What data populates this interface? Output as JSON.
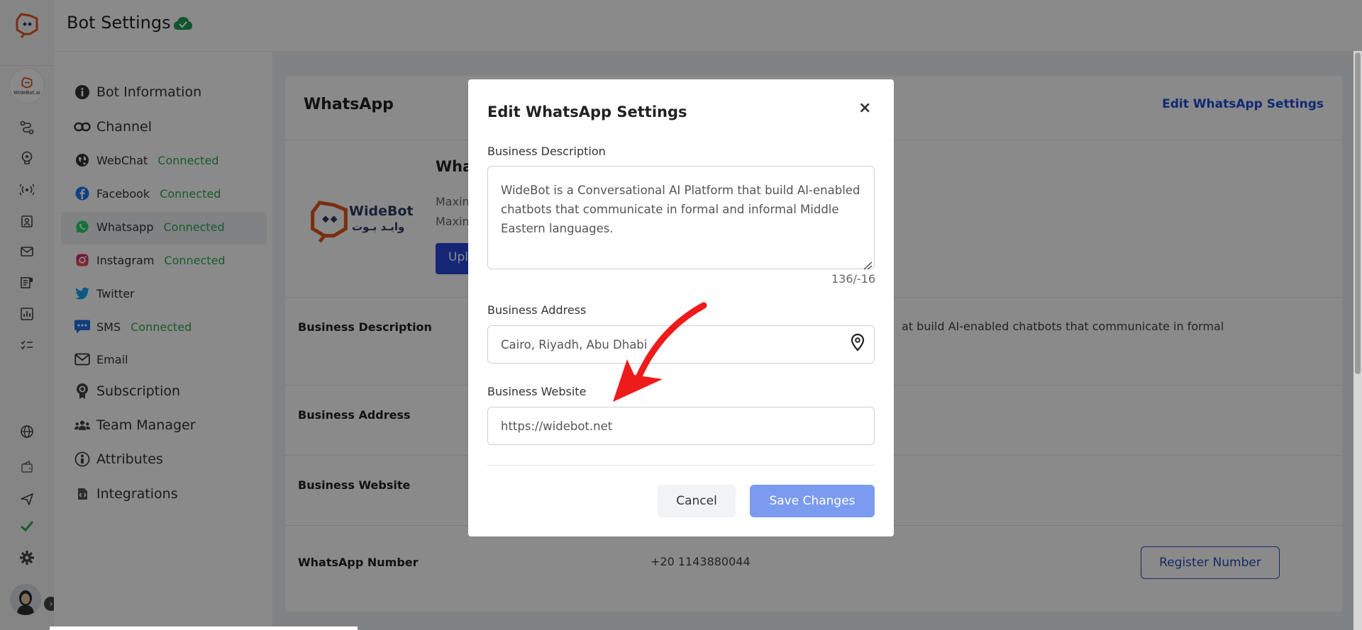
{
  "header": {
    "title": "Bot Settings"
  },
  "rail": {
    "bot_badge_label": "WideBot.ai"
  },
  "sidebar": {
    "bot_information": "Bot Information",
    "channel": "Channel",
    "channels": [
      {
        "name": "WebChat",
        "status": "Connected"
      },
      {
        "name": "Facebook",
        "status": "Connected"
      },
      {
        "name": "Whatsapp",
        "status": "Connected"
      },
      {
        "name": "Instagram",
        "status": "Connected"
      },
      {
        "name": "Twitter",
        "status": ""
      },
      {
        "name": "SMS",
        "status": "Connected"
      },
      {
        "name": "Email",
        "status": ""
      }
    ],
    "subscription": "Subscription",
    "team_manager": "Team Manager",
    "attributes": "Attributes",
    "integrations": "Integrations"
  },
  "card": {
    "title": "WhatsApp",
    "edit_link": "Edit WhatsApp Settings",
    "logo_en": "WideBot",
    "logo_ar": "وايـد بـوت",
    "name_partial": "Wha",
    "desc_line1": "Maxin",
    "desc_line2": "Maxin",
    "upload_partial": "Upl",
    "rows": {
      "business_description_label": "Business Description",
      "business_description_value": "at build AI-enabled chatbots that communicate in formal",
      "business_address_label": "Business Address",
      "business_website_label": "Business Website",
      "whatsapp_number_label": "WhatsApp Number",
      "whatsapp_number_value": "+20 1143880044",
      "register_button": "Register Number"
    }
  },
  "modal": {
    "title": "Edit WhatsApp Settings",
    "close": "×",
    "description_label": "Business Description",
    "description_value": "WideBot is a Conversational AI Platform that build AI-enabled chatbots that communicate in formal and informal Middle Eastern languages.",
    "char_count": "136/-16",
    "address_label": "Business Address",
    "address_value": "Cairo, Riyadh, Abu Dhabi",
    "website_label": "Business Website",
    "website_value": "https://widebot.net",
    "cancel": "Cancel",
    "save": "Save Changes"
  },
  "colors": {
    "primary": "#2546d6",
    "save_button": "#7b9bf0",
    "connected": "#2fa84f",
    "brand_orange": "#e2561d",
    "annotation_arrow": "#ee1b1b"
  }
}
